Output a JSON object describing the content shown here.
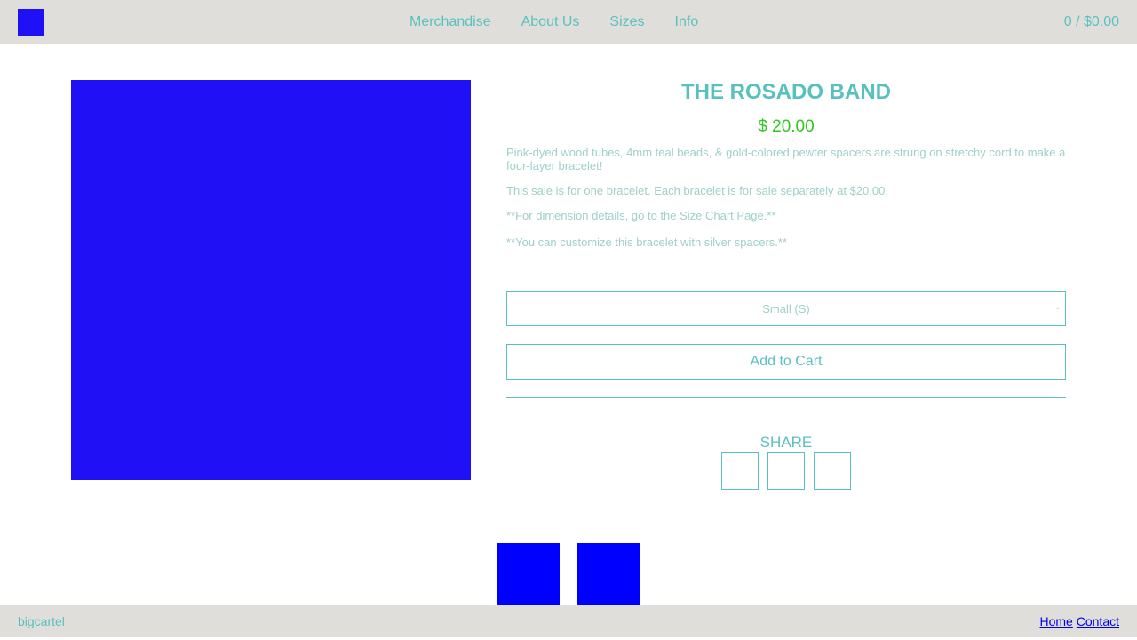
{
  "header": {
    "nav": [
      "Merchandise",
      "About Us",
      "Sizes",
      "Info"
    ],
    "cart": "0 / $0.00",
    "logo_icon": "store-logo"
  },
  "product": {
    "title": "THE ROSADO BAND",
    "price": "$ 20.00",
    "description": [
      "Pink-dyed wood tubes, 4mm teal beads, & gold-colored pewter spacers are strung on stretchy cord to make a four-layer bracelet!",
      "This sale is for one bracelet. Each bracelet is for sale separately at $20.00.",
      "**For dimension details, go to the Size Chart Page.**",
      "**You can customize this bracelet with silver spacers.**"
    ],
    "size_select": "Small (S)",
    "add_to_cart": "Add to Cart",
    "share_label": "SHARE"
  },
  "footer": {
    "brand": "bigcartel",
    "links": [
      "Home",
      "Contact"
    ]
  },
  "colors": {
    "accent": "#58c1c0",
    "price": "#2ec91f",
    "image_placeholder": "#1f10f5",
    "thumb_placeholder": "#0000ff",
    "bar_bg": "#e0deda"
  }
}
